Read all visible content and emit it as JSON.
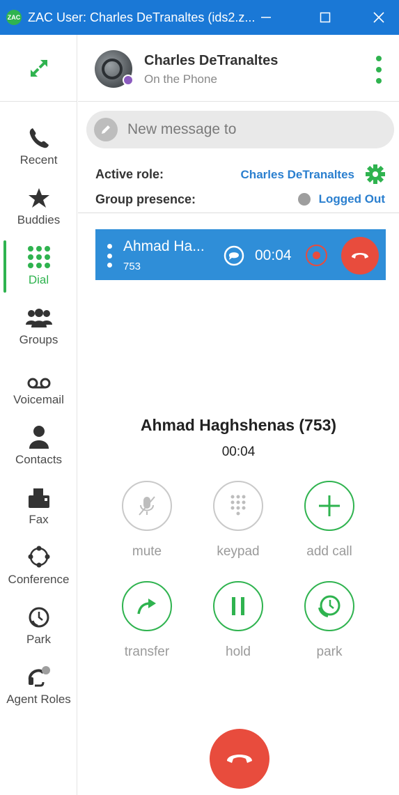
{
  "window": {
    "title": "ZAC User: Charles DeTranaltes (ids2.z...",
    "app_icon": "ZAC"
  },
  "sidebar": {
    "items": [
      {
        "label": "Recent",
        "icon": "phone-icon"
      },
      {
        "label": "Buddies",
        "icon": "star-icon"
      },
      {
        "label": "Dial",
        "icon": "dialpad-icon",
        "active": true
      },
      {
        "label": "Groups",
        "icon": "groups-icon"
      },
      {
        "label": "Voicemail",
        "icon": "voicemail-icon"
      },
      {
        "label": "Contacts",
        "icon": "contact-icon"
      },
      {
        "label": "Fax",
        "icon": "fax-icon"
      },
      {
        "label": "Conference",
        "icon": "conference-icon"
      },
      {
        "label": "Park",
        "icon": "park-clock-icon"
      },
      {
        "label": "Agent Roles",
        "icon": "agent-headset-icon"
      }
    ]
  },
  "header": {
    "name": "Charles DeTranaltes",
    "status": "On the Phone"
  },
  "message": {
    "placeholder": "New message to"
  },
  "roles": {
    "active_role_label": "Active role:",
    "active_role_value": "Charles DeTranaltes",
    "group_presence_label": "Group presence:",
    "group_presence_value": "Logged Out"
  },
  "active_call": {
    "name": "Ahmad Ha...",
    "extension": "753",
    "timer": "00:04"
  },
  "call_detail": {
    "callee": "Ahmad Haghshenas (753)",
    "duration": "00:04",
    "controls": [
      {
        "label": "mute",
        "icon": "mic-off-icon",
        "enabled": false
      },
      {
        "label": "keypad",
        "icon": "keypad-icon",
        "enabled": false
      },
      {
        "label": "add call",
        "icon": "plus-icon",
        "enabled": true
      },
      {
        "label": "transfer",
        "icon": "transfer-arrow-icon",
        "enabled": true
      },
      {
        "label": "hold",
        "icon": "pause-icon",
        "enabled": true
      },
      {
        "label": "park",
        "icon": "park-clock-icon",
        "enabled": true
      }
    ]
  },
  "colors": {
    "titlebar": "#1a78d6",
    "accent_green": "#2fb34f",
    "call_blue": "#2f8ed8",
    "hangup_red": "#e84c3d",
    "link_blue": "#2a7fcf"
  }
}
